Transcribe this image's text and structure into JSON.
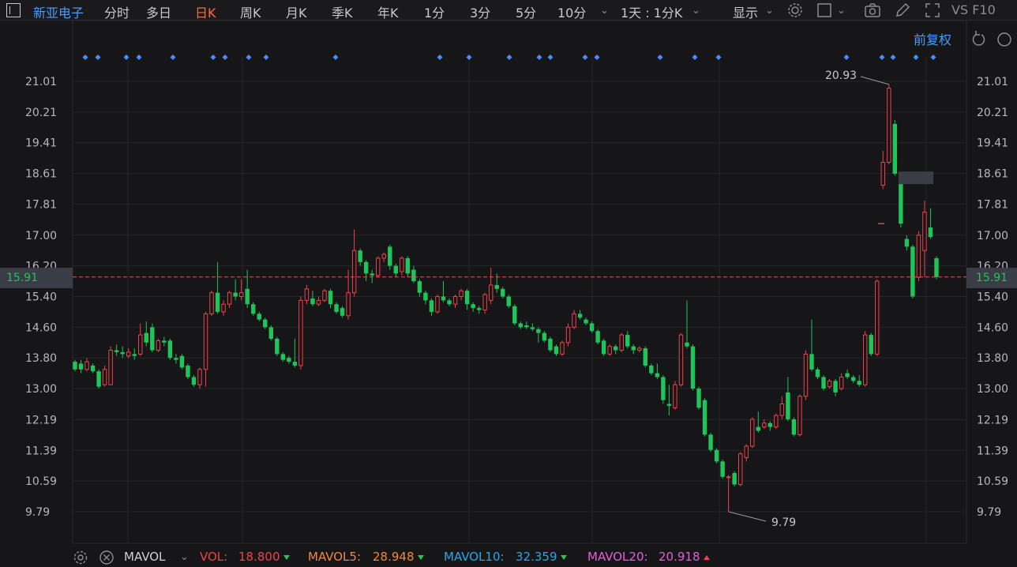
{
  "toolbar": {
    "stock_name": "新亚电子",
    "periods": [
      "分时",
      "多日",
      "日K",
      "周K",
      "月K",
      "季K",
      "年K",
      "1分",
      "3分",
      "5分",
      "10分"
    ],
    "active_period": "日K",
    "interval_select": "1天 : 1分K",
    "display_label": "显示",
    "f10_label": "VS F10"
  },
  "chart": {
    "adjust_label": "前复权",
    "current_price": "15.91",
    "y_ticks": [
      "21.01",
      "20.21",
      "19.41",
      "18.61",
      "17.81",
      "17.00",
      "16.20",
      "15.40",
      "14.60",
      "13.80",
      "13.00",
      "12.19",
      "11.39",
      "10.59",
      "9.79"
    ],
    "max_label": "20.93",
    "min_label": "9.79"
  },
  "chart_data": {
    "type": "candlestick",
    "ylim": [
      9.79,
      21.01
    ],
    "y_ticks": [
      21.01,
      20.21,
      19.41,
      18.61,
      17.81,
      17.0,
      16.2,
      15.4,
      14.6,
      13.8,
      13.0,
      12.19,
      11.39,
      10.59,
      9.79
    ],
    "current_price": 15.91,
    "high_annotation": 20.93,
    "low_annotation": 9.79,
    "candles": [
      [
        13.7,
        13.5,
        13.75,
        13.45
      ],
      [
        13.65,
        13.5,
        13.75,
        13.4
      ],
      [
        13.5,
        13.7,
        13.8,
        13.45
      ],
      [
        13.6,
        13.45,
        13.65,
        13.4
      ],
      [
        13.45,
        13.05,
        13.5,
        13.0
      ],
      [
        13.1,
        13.5,
        13.6,
        13.05
      ],
      [
        13.1,
        14.0,
        14.1,
        13.1
      ],
      [
        14.0,
        13.95,
        14.15,
        13.85
      ],
      [
        13.95,
        13.9,
        14.1,
        13.8
      ],
      [
        13.85,
        13.95,
        14.05,
        13.8
      ],
      [
        13.9,
        13.85,
        14.05,
        13.75
      ],
      [
        13.9,
        14.4,
        14.7,
        13.85
      ],
      [
        14.45,
        14.2,
        14.75,
        14.1
      ],
      [
        14.6,
        14.0,
        14.7,
        13.95
      ],
      [
        14.0,
        14.25,
        14.3,
        13.95
      ],
      [
        14.25,
        14.2,
        14.35,
        14.1
      ],
      [
        14.25,
        13.8,
        14.3,
        13.75
      ],
      [
        13.8,
        13.75,
        13.9,
        13.65
      ],
      [
        13.85,
        13.55,
        13.9,
        13.5
      ],
      [
        13.6,
        13.3,
        13.65,
        13.25
      ],
      [
        13.3,
        13.1,
        13.35,
        13.05
      ],
      [
        13.1,
        13.5,
        13.55,
        13.0
      ],
      [
        13.5,
        14.95,
        15.0,
        13.05
      ],
      [
        14.95,
        15.5,
        15.55,
        14.9
      ],
      [
        15.5,
        15.0,
        16.3,
        14.95
      ],
      [
        15.0,
        15.2,
        15.3,
        14.9
      ],
      [
        15.2,
        15.5,
        15.55,
        15.1
      ],
      [
        15.5,
        15.4,
        15.85,
        15.3
      ],
      [
        15.4,
        15.5,
        15.85,
        15.3
      ],
      [
        15.6,
        15.2,
        16.1,
        15.1
      ],
      [
        15.2,
        14.95,
        15.25,
        14.9
      ],
      [
        14.95,
        14.8,
        15.0,
        14.75
      ],
      [
        14.8,
        14.6,
        14.85,
        14.55
      ],
      [
        14.6,
        14.3,
        14.65,
        14.25
      ],
      [
        14.3,
        13.9,
        14.35,
        13.85
      ],
      [
        13.9,
        13.75,
        13.95,
        13.7
      ],
      [
        13.8,
        13.7,
        13.85,
        13.65
      ],
      [
        13.7,
        13.6,
        14.3,
        13.55
      ],
      [
        13.6,
        15.3,
        15.4,
        13.5
      ],
      [
        15.3,
        15.6,
        15.7,
        15.2
      ],
      [
        15.35,
        15.2,
        15.55,
        15.15
      ],
      [
        15.2,
        15.3,
        15.4,
        15.15
      ],
      [
        15.3,
        15.55,
        15.6,
        15.25
      ],
      [
        15.55,
        15.2,
        15.6,
        15.1
      ],
      [
        15.2,
        15.0,
        15.25,
        14.95
      ],
      [
        15.1,
        14.9,
        15.15,
        14.85
      ],
      [
        14.9,
        15.5,
        16.1,
        14.8
      ],
      [
        15.5,
        16.6,
        17.15,
        15.4
      ],
      [
        16.6,
        16.3,
        16.65,
        16.2
      ],
      [
        16.3,
        16.0,
        16.35,
        15.8
      ],
      [
        16.0,
        15.95,
        16.1,
        15.75
      ],
      [
        15.95,
        16.4,
        16.45,
        15.9
      ],
      [
        16.4,
        16.5,
        16.55,
        16.3
      ],
      [
        16.7,
        16.2,
        16.75,
        16.1
      ],
      [
        16.2,
        16.0,
        16.25,
        15.9
      ],
      [
        16.05,
        16.4,
        16.45,
        15.95
      ],
      [
        16.4,
        16.0,
        16.45,
        15.9
      ],
      [
        16.1,
        15.8,
        16.2,
        15.75
      ],
      [
        15.8,
        15.5,
        15.85,
        15.4
      ],
      [
        15.5,
        15.3,
        15.55,
        15.2
      ],
      [
        15.3,
        15.0,
        15.35,
        14.9
      ],
      [
        15.0,
        15.4,
        15.45,
        14.95
      ],
      [
        15.4,
        15.3,
        15.8,
        15.25
      ],
      [
        15.3,
        15.2,
        15.35,
        15.15
      ],
      [
        15.2,
        15.4,
        15.45,
        15.1
      ],
      [
        15.4,
        15.55,
        15.6,
        15.3
      ],
      [
        15.55,
        15.2,
        15.6,
        15.05
      ],
      [
        15.2,
        15.1,
        15.25,
        15.0
      ],
      [
        15.1,
        15.05,
        15.15,
        14.95
      ],
      [
        15.05,
        15.45,
        15.5,
        14.95
      ],
      [
        15.3,
        15.7,
        16.15,
        15.2
      ],
      [
        15.7,
        15.6,
        16.0,
        15.5
      ],
      [
        15.6,
        15.4,
        15.65,
        15.35
      ],
      [
        15.4,
        15.15,
        15.45,
        15.1
      ],
      [
        15.15,
        14.7,
        15.2,
        14.65
      ],
      [
        14.7,
        14.6,
        14.75,
        14.55
      ],
      [
        14.65,
        14.6,
        14.75,
        14.55
      ],
      [
        14.6,
        14.55,
        14.7,
        14.5
      ],
      [
        14.55,
        14.45,
        14.6,
        14.2
      ],
      [
        14.45,
        14.25,
        14.5,
        14.2
      ],
      [
        14.3,
        14.0,
        14.35,
        13.95
      ],
      [
        14.1,
        13.9,
        14.15,
        13.85
      ],
      [
        13.9,
        14.2,
        14.25,
        13.85
      ],
      [
        14.2,
        14.6,
        14.7,
        14.1
      ],
      [
        14.6,
        14.95,
        15.05,
        14.55
      ],
      [
        14.95,
        14.85,
        15.05,
        14.8
      ],
      [
        14.8,
        14.7,
        14.85,
        14.65
      ],
      [
        14.7,
        14.5,
        14.75,
        14.45
      ],
      [
        14.5,
        14.2,
        14.55,
        14.15
      ],
      [
        14.25,
        13.9,
        14.3,
        13.85
      ],
      [
        13.9,
        14.1,
        14.15,
        13.85
      ],
      [
        14.1,
        14.0,
        14.15,
        13.9
      ],
      [
        14.0,
        14.4,
        14.45,
        13.95
      ],
      [
        14.4,
        14.1,
        14.5,
        14.05
      ],
      [
        14.1,
        14.0,
        14.15,
        13.9
      ],
      [
        14.0,
        14.05,
        14.1,
        13.95
      ],
      [
        14.05,
        13.6,
        14.1,
        13.55
      ],
      [
        13.6,
        13.4,
        13.65,
        13.35
      ],
      [
        13.4,
        13.3,
        13.65,
        13.25
      ],
      [
        13.3,
        12.7,
        13.35,
        12.6
      ],
      [
        12.6,
        12.55,
        13.1,
        12.3
      ],
      [
        12.5,
        13.1,
        13.2,
        12.45
      ],
      [
        13.1,
        14.4,
        14.45,
        13.05
      ],
      [
        14.2,
        14.1,
        15.3,
        14.05
      ],
      [
        14.1,
        13.0,
        14.15,
        12.95
      ],
      [
        13.0,
        12.5,
        13.05,
        12.45
      ],
      [
        12.7,
        11.8,
        12.75,
        11.75
      ],
      [
        11.8,
        11.4,
        11.85,
        11.35
      ],
      [
        11.4,
        11.1,
        11.45,
        11.05
      ],
      [
        11.1,
        10.7,
        11.15,
        10.65
      ],
      [
        10.7,
        10.7,
        10.75,
        9.79
      ],
      [
        10.8,
        10.5,
        10.85,
        10.45
      ],
      [
        10.5,
        11.3,
        11.35,
        10.45
      ],
      [
        11.2,
        11.5,
        11.55,
        11.1
      ],
      [
        11.5,
        12.2,
        12.25,
        11.45
      ],
      [
        12.0,
        11.9,
        12.4,
        11.85
      ],
      [
        12.0,
        12.1,
        12.2,
        11.95
      ],
      [
        12.1,
        12.0,
        12.15,
        11.9
      ],
      [
        12.0,
        12.3,
        12.35,
        11.95
      ],
      [
        12.3,
        12.6,
        12.8,
        12.2
      ],
      [
        12.9,
        12.2,
        13.3,
        12.15
      ],
      [
        12.2,
        11.8,
        12.25,
        11.75
      ],
      [
        11.8,
        12.8,
        12.85,
        11.75
      ],
      [
        12.8,
        13.9,
        14.0,
        12.7
      ],
      [
        13.9,
        13.5,
        14.8,
        13.45
      ],
      [
        13.5,
        13.3,
        13.55,
        13.25
      ],
      [
        13.3,
        13.0,
        13.35,
        12.95
      ],
      [
        13.05,
        13.2,
        13.25,
        13.0
      ],
      [
        13.2,
        12.9,
        13.25,
        12.8
      ],
      [
        13.0,
        13.3,
        13.4,
        12.95
      ],
      [
        13.4,
        13.3,
        13.5,
        13.25
      ],
      [
        13.3,
        13.2,
        13.35,
        13.15
      ],
      [
        13.2,
        13.1,
        13.35,
        13.05
      ],
      [
        13.1,
        14.4,
        14.5,
        13.05
      ],
      [
        14.4,
        13.9,
        14.45,
        13.85
      ],
      [
        13.9,
        15.8,
        15.85,
        13.85
      ],
      [
        18.3,
        18.9,
        19.2,
        18.2
      ],
      [
        18.9,
        20.83,
        20.93,
        18.85
      ],
      [
        19.9,
        18.6,
        20.0,
        18.55
      ],
      [
        18.4,
        17.3,
        18.45,
        17.2
      ],
      [
        16.9,
        16.7,
        17.0,
        16.6
      ],
      [
        16.7,
        15.4,
        16.75,
        15.35
      ],
      [
        15.9,
        17.0,
        17.1,
        15.8
      ],
      [
        16.6,
        17.6,
        17.9,
        15.9
      ],
      [
        17.2,
        16.95,
        17.7,
        16.9
      ],
      [
        16.4,
        15.91,
        16.45,
        15.85
      ]
    ],
    "volume_panel": {
      "indicator": "MAVOL",
      "VOL": 18.8,
      "MAVOL5": 28.948,
      "MAVOL10": 32.359,
      "MAVOL20": 20.918
    }
  },
  "indicators": {
    "select": "MAVOL",
    "vol_label": "VOL:",
    "vol_value": "18.800",
    "mavol5_label": "MAVOL5:",
    "mavol5_value": "28.948",
    "mavol10_label": "MAVOL10:",
    "mavol10_value": "32.359",
    "mavol20_label": "MAVOL20:",
    "mavol20_value": "20.918"
  },
  "colors": {
    "up": "#f0414a",
    "down": "#1fc45a",
    "price_line": "#e05a3a",
    "marker": "#4c8bf5",
    "active_tab": "#ff6a3d",
    "mavol5": "#f0883e",
    "mavol10": "#27a8e6",
    "mavol20": "#e060d8"
  }
}
